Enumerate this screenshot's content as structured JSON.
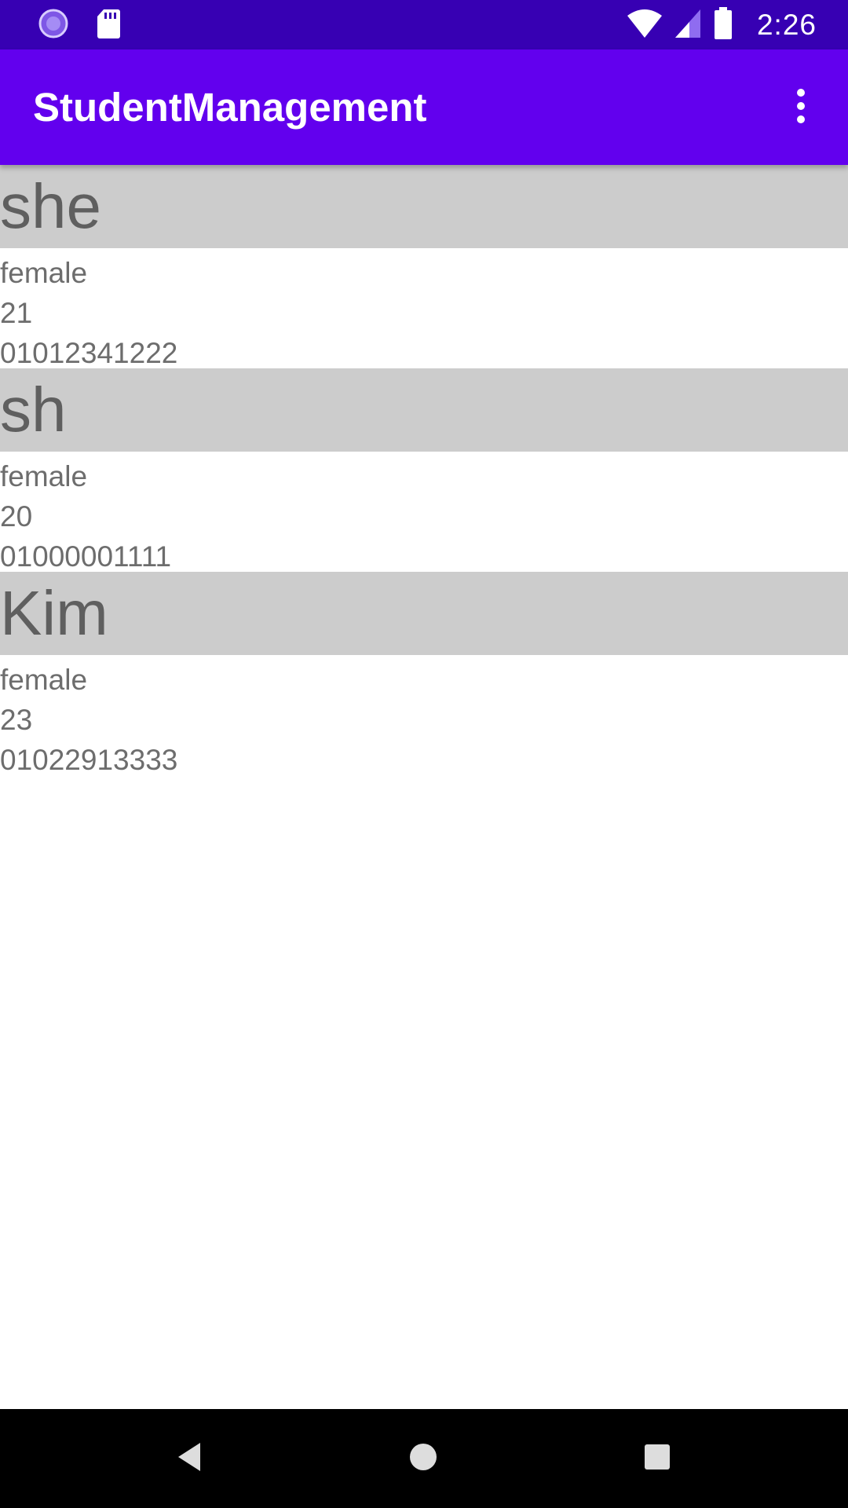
{
  "status_bar": {
    "time": "2:26",
    "icons": [
      "progress-icon",
      "sd-card-icon",
      "wifi-icon",
      "signal-icon",
      "battery-icon"
    ]
  },
  "app_bar": {
    "title": "StudentManagement",
    "overflow_icon": "more-vert-icon"
  },
  "students": [
    {
      "name": "she",
      "gender": "female",
      "age": "21",
      "phone": "01012341222"
    },
    {
      "name": "sh",
      "gender": "female",
      "age": "20",
      "phone": "01000001111"
    },
    {
      "name": "Kim",
      "gender": "female",
      "age": "23",
      "phone": "01022913333"
    }
  ],
  "nav_bar": {
    "icons": [
      "back-icon",
      "home-icon",
      "recents-icon"
    ]
  },
  "colors": {
    "status_bar": "#3700b3",
    "app_bar": "#6200ee",
    "name_header_bg": "#cccccc",
    "nav_bar": "#000000"
  }
}
